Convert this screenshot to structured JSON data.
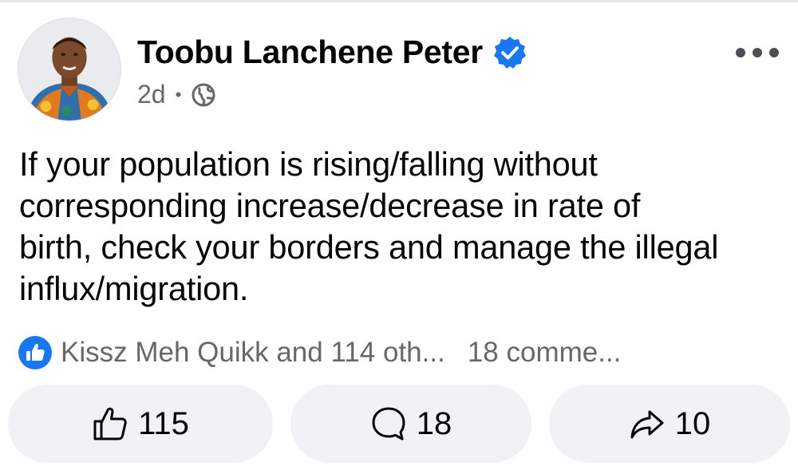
{
  "post": {
    "author": "Toobu Lanchene Peter",
    "verified": true,
    "time": "2d",
    "separator": "•",
    "audience_icon": "globe-icon",
    "text_lines": [
      "If your population is rising/falling without",
      "corresponding increase/decrease in rate of",
      "birth, check your borders and manage the illegal",
      "influx/migration."
    ]
  },
  "stats": {
    "reactions_text": "Kissz Meh Quikk and 114 oth...",
    "comments_text": "18 comme..."
  },
  "actions": {
    "like_count": "115",
    "comment_count": "18",
    "share_count": "10"
  },
  "colors": {
    "accent": "#1877f2",
    "muted": "#65676b",
    "button_bg": "#f0f2f5"
  }
}
